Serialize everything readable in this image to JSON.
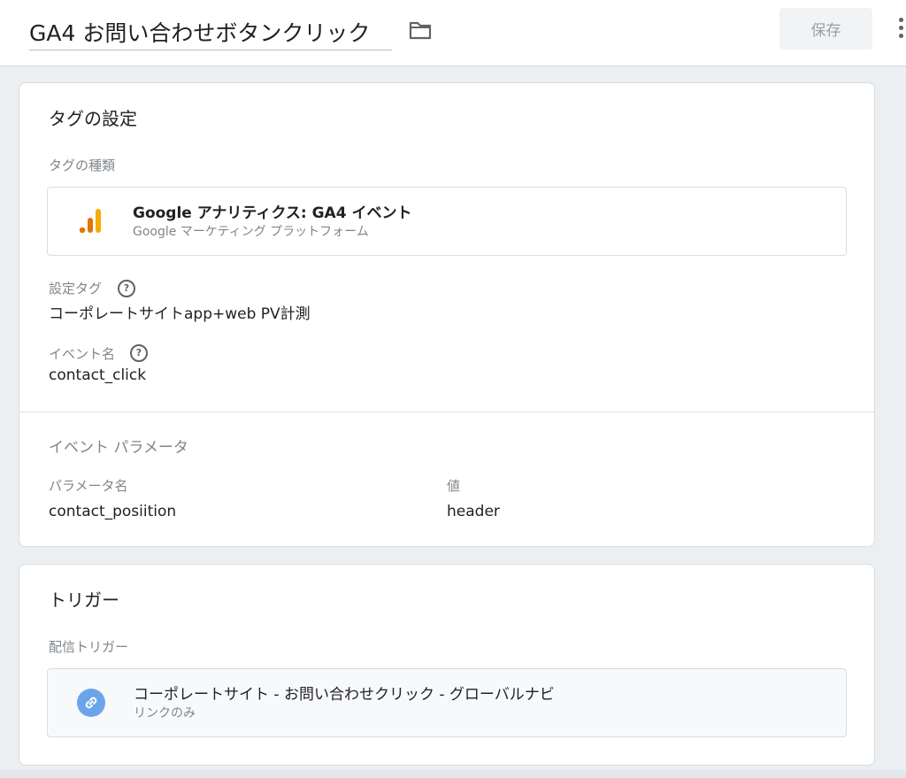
{
  "header": {
    "title": "GA4 お問い合わせボタンクリック",
    "save_label": "保存",
    "folder_icon": "folder-icon",
    "more_icon": "more-vert-icon"
  },
  "tag_settings": {
    "title": "タグの設定",
    "tag_type_label": "タグの種類",
    "tag_type": {
      "name": "Google アナリティクス: GA4 イベント",
      "platform": "Google マーケティング プラットフォーム",
      "icon": "google-analytics-icon"
    },
    "config_tag_label": "設定タグ",
    "config_tag_value": "コーポレートサイトapp+web PV計測",
    "event_name_label": "イベント名",
    "event_name_value": "contact_click",
    "event_params_title": "イベント パラメータ",
    "param_name_header": "パラメータ名",
    "param_value_header": "値",
    "params": [
      {
        "name": "contact_posiition",
        "value": "header"
      }
    ]
  },
  "trigger": {
    "title": "トリガー",
    "firing_label": "配信トリガー",
    "item": {
      "name": "コーポレートサイト - お問い合わせクリック - グローバルナビ",
      "type": "リンクのみ",
      "icon": "link-icon"
    }
  },
  "colors": {
    "analytics_orange": "#e37400",
    "analytics_yellow": "#f9ab00",
    "link_badge_blue": "#6aa5ea"
  }
}
